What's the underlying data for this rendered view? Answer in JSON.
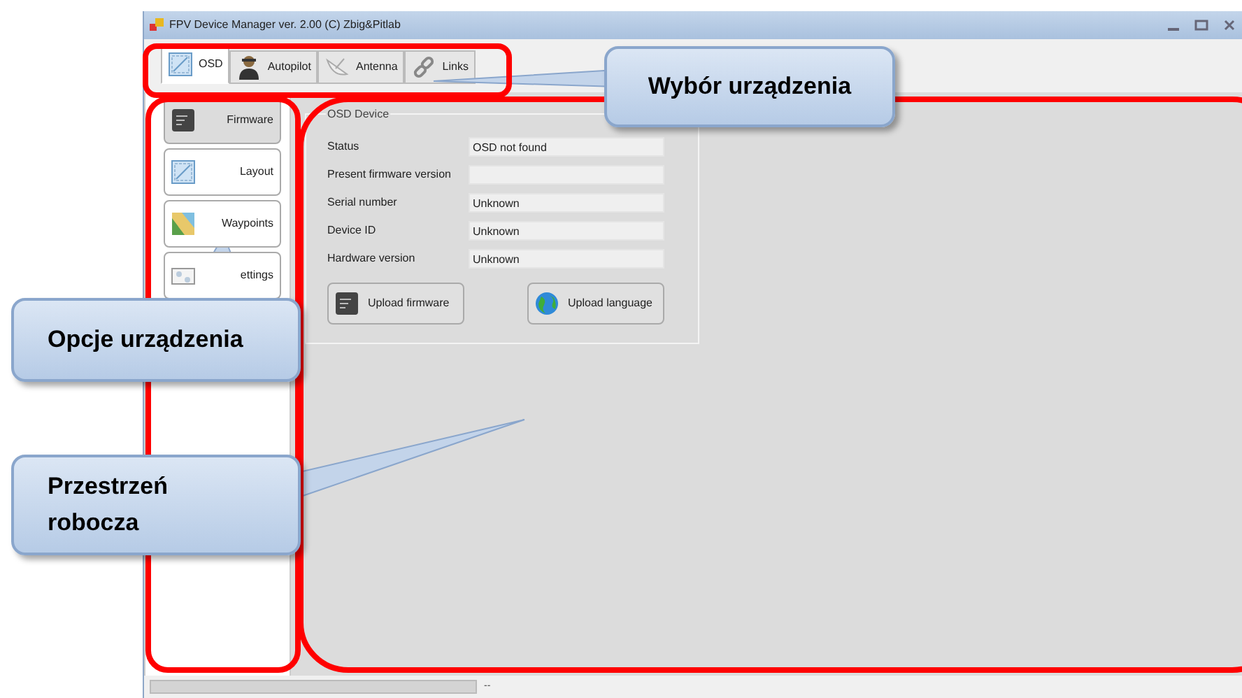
{
  "window": {
    "title": "FPV Device Manager ver. 2.00 (C) Zbig&Pitlab"
  },
  "tabs": [
    {
      "label": "OSD",
      "kind": "screen",
      "selected": true
    },
    {
      "label": "Autopilot",
      "kind": "person",
      "selected": false
    },
    {
      "label": "Antenna",
      "kind": "dish",
      "selected": false
    },
    {
      "label": "Links",
      "kind": "chain",
      "selected": false
    }
  ],
  "options": [
    {
      "label": "Firmware",
      "kind": "chip",
      "selected": true
    },
    {
      "label": "Layout",
      "kind": "screen",
      "selected": false
    },
    {
      "label": "Waypoints",
      "kind": "map",
      "selected": false
    },
    {
      "label": "ettings",
      "kind": "sliders",
      "selected": false
    }
  ],
  "group": {
    "title": "OSD Device",
    "fields": [
      {
        "label": "Status",
        "value": "OSD not found"
      },
      {
        "label": "Present firmware version"
      },
      {
        "label": "Serial number",
        "value": "Unknown"
      },
      {
        "label": "Device ID",
        "value": "Unknown"
      },
      {
        "label": "Hardware version",
        "value": "Unknown"
      }
    ],
    "buttons": [
      {
        "label": "Upload firmware",
        "kind": "chip"
      },
      {
        "label": "Upload language",
        "kind": "globe"
      }
    ]
  },
  "status_bar": {
    "text": "--"
  },
  "annotations": [
    {
      "text": "Wybór urządzenia"
    },
    {
      "text": "Opcje urządzenia"
    },
    {
      "text": "Przestrzeń robocza"
    }
  ]
}
